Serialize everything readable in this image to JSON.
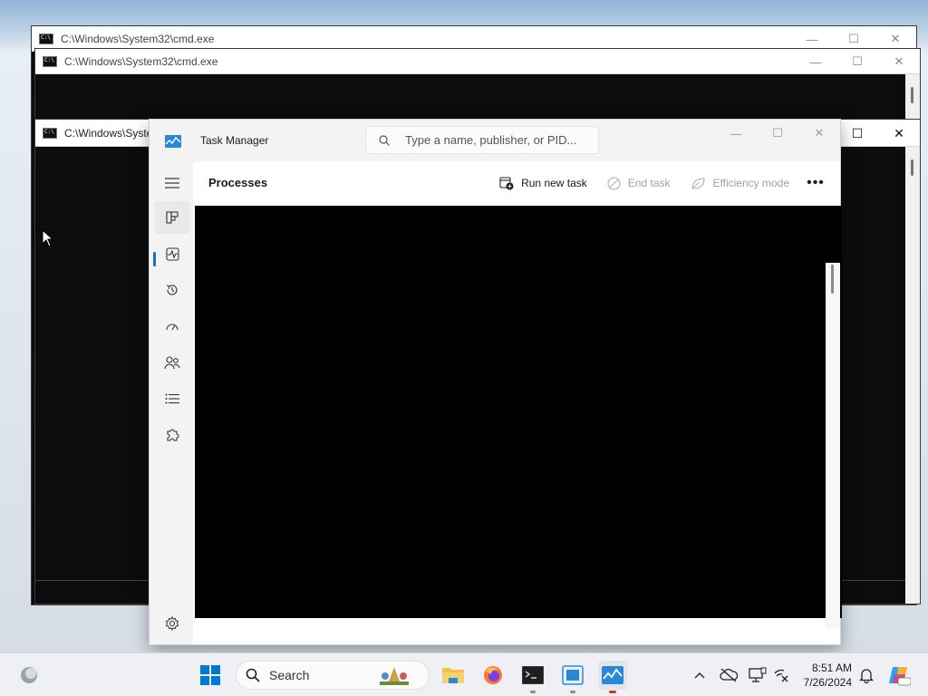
{
  "cmd_windows": [
    {
      "title": "C:\\Windows\\System32\\cmd.exe"
    },
    {
      "title": "C:\\Windows\\System32\\cmd.exe"
    },
    {
      "title": "C:\\Windows\\Syste"
    }
  ],
  "task_manager": {
    "title": "Task Manager",
    "search_placeholder": "Type a name, publisher, or PID...",
    "page_title": "Processes",
    "toolbar": {
      "run_new_task": "Run new task",
      "end_task": "End task",
      "efficiency_mode": "Efficiency mode",
      "more": "•••"
    },
    "nav": [
      {
        "name": "menu-icon",
        "active": false
      },
      {
        "name": "processes-icon",
        "active": true
      },
      {
        "name": "performance-icon",
        "active": false
      },
      {
        "name": "app-history-icon",
        "active": false
      },
      {
        "name": "startup-apps-icon",
        "active": false
      },
      {
        "name": "users-icon",
        "active": false
      },
      {
        "name": "details-icon",
        "active": false
      },
      {
        "name": "services-icon",
        "active": false
      },
      {
        "name": "settings-icon",
        "active": false
      }
    ],
    "accent_color": "#1a6fc4"
  },
  "taskbar": {
    "search_label": "Search",
    "time": "8:51 AM",
    "date": "7/26/2024",
    "apps": [
      "start-icon",
      "search",
      "file-explorer-icon",
      "firefox-icon",
      "terminal-icon",
      "remote-desktop-icon",
      "task-manager-icon"
    ]
  }
}
